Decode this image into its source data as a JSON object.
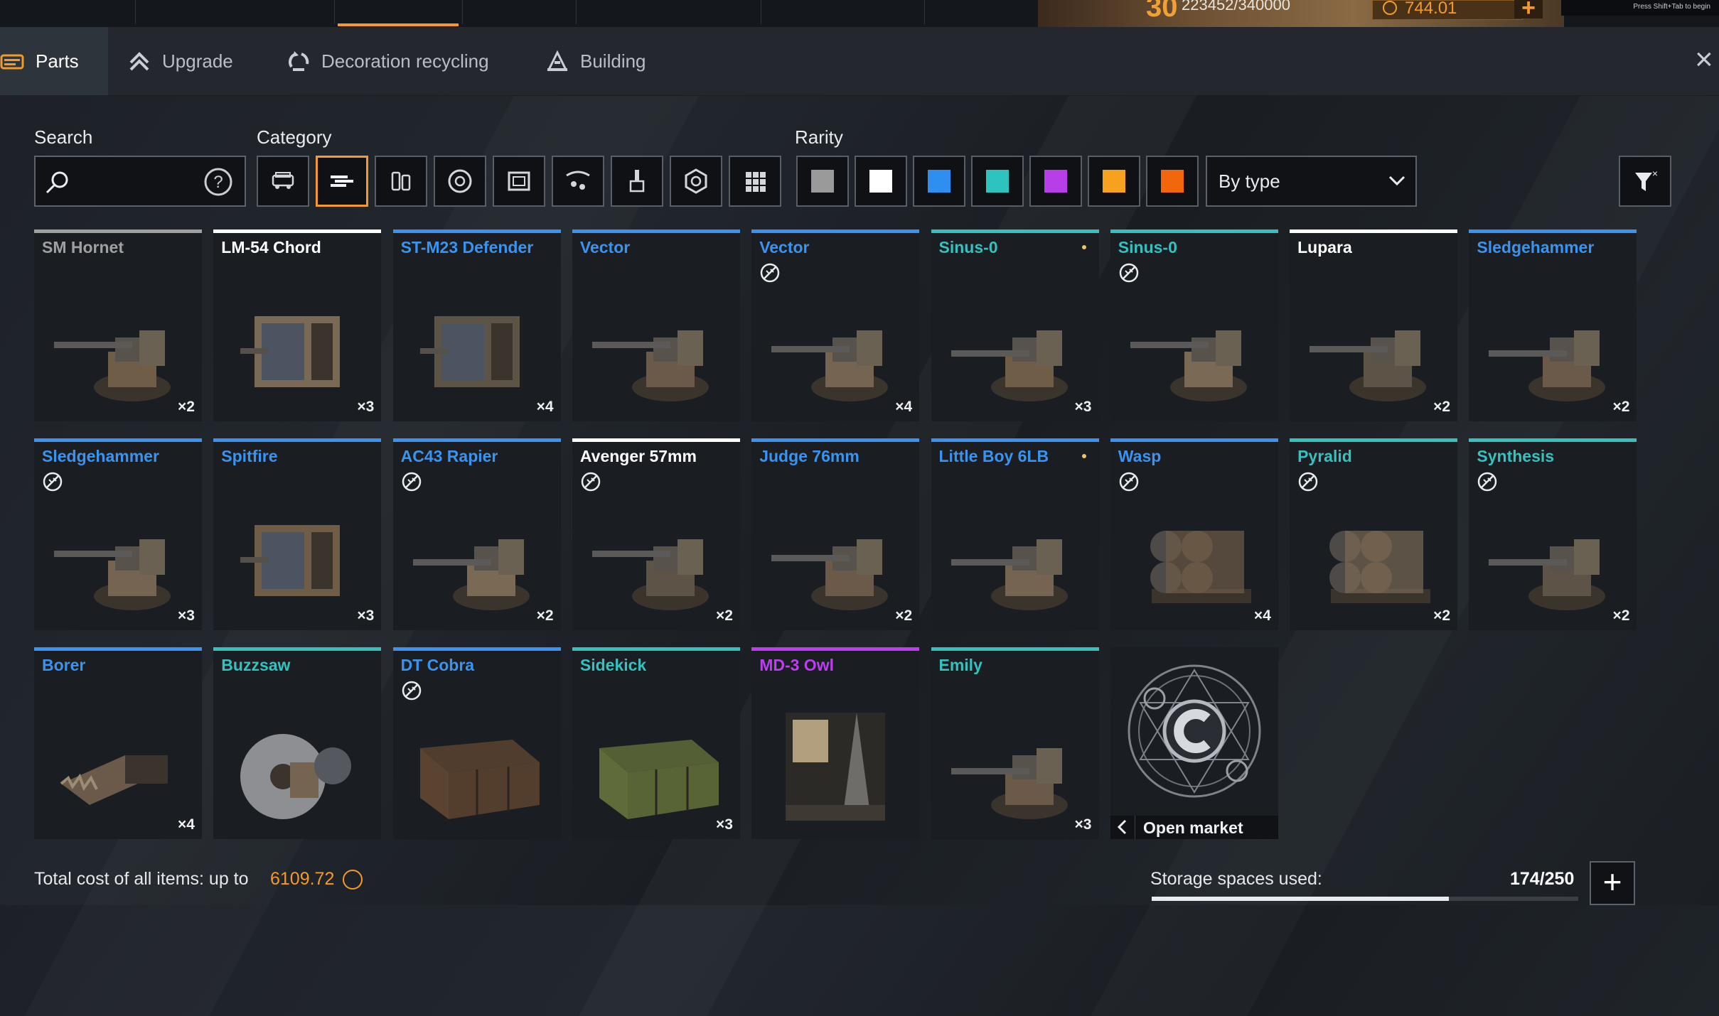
{
  "topbar": {
    "player_level": "30",
    "player_xp": "223452/340000",
    "coins": "744.01",
    "add_coins": "+",
    "hint": "Press Shift+Tab to begin"
  },
  "tabs": [
    {
      "label": "Parts",
      "icon": "parts-icon",
      "active": true
    },
    {
      "label": "Upgrade",
      "icon": "upgrade-icon",
      "active": false
    },
    {
      "label": "Decoration recycling",
      "icon": "recycling-icon",
      "active": false
    },
    {
      "label": "Building",
      "icon": "building-icon",
      "active": false
    }
  ],
  "close": "×",
  "filters": {
    "search_label": "Search",
    "category_label": "Category",
    "rarity_label": "Rarity",
    "categories": [
      "cabins-icon",
      "weapons-icon",
      "modules-icon",
      "wheels-icon",
      "frames-icon",
      "decor-icon",
      "paint-icon",
      "engines-icon",
      "all-icon"
    ],
    "selected_category": 1,
    "rarities": [
      {
        "name": "common",
        "color": "#9a9a9a"
      },
      {
        "name": "rare",
        "color": "#ffffff"
      },
      {
        "name": "special",
        "color": "#2e8ff0"
      },
      {
        "name": "epic",
        "color": "#2fc3c0"
      },
      {
        "name": "legendary",
        "color": "#b83ee8"
      },
      {
        "name": "relic",
        "color": "#f7a21e"
      },
      {
        "name": "exotic",
        "color": "#f2660c"
      }
    ],
    "sort": "By type"
  },
  "rarity_colors": {
    "common": "#a0a0a0",
    "rare": "#ffffff",
    "special": "#3a94ef",
    "epic": "#35c1bd",
    "legendary": "#bd3ef0"
  },
  "items": [
    {
      "name": "SM Hornet",
      "rarity": "common",
      "qty": "×2",
      "craftable": false,
      "dot": false
    },
    {
      "name": "LM-54 Chord",
      "rarity": "rare",
      "qty": "×3",
      "craftable": false,
      "dot": false
    },
    {
      "name": "ST-M23 Defender",
      "rarity": "special",
      "qty": "×4",
      "craftable": false,
      "dot": false
    },
    {
      "name": "Vector",
      "rarity": "special",
      "qty": "",
      "craftable": false,
      "dot": false
    },
    {
      "name": "Vector",
      "rarity": "special",
      "qty": "×4",
      "craftable": true,
      "dot": false
    },
    {
      "name": "Sinus-0",
      "rarity": "epic",
      "qty": "×3",
      "craftable": false,
      "dot": true
    },
    {
      "name": "Sinus-0",
      "rarity": "epic",
      "qty": "",
      "craftable": true,
      "dot": false
    },
    {
      "name": "Lupara",
      "rarity": "rare",
      "qty": "×2",
      "craftable": false,
      "dot": false
    },
    {
      "name": "Sledgehammer",
      "rarity": "special",
      "qty": "×2",
      "craftable": false,
      "dot": false
    },
    {
      "name": "Sledgehammer",
      "rarity": "special",
      "qty": "×3",
      "craftable": true,
      "dot": false
    },
    {
      "name": "Spitfire",
      "rarity": "special",
      "qty": "×3",
      "craftable": false,
      "dot": false
    },
    {
      "name": "AC43 Rapier",
      "rarity": "special",
      "qty": "×2",
      "craftable": true,
      "dot": false
    },
    {
      "name": "Avenger 57mm",
      "rarity": "rare",
      "qty": "×2",
      "craftable": true,
      "dot": false
    },
    {
      "name": "Judge 76mm",
      "rarity": "special",
      "qty": "×2",
      "craftable": false,
      "dot": false
    },
    {
      "name": "Little Boy 6LB",
      "rarity": "special",
      "qty": "",
      "craftable": false,
      "dot": true
    },
    {
      "name": "Wasp",
      "rarity": "special",
      "qty": "×4",
      "craftable": true,
      "dot": false
    },
    {
      "name": "Pyralid",
      "rarity": "epic",
      "qty": "×2",
      "craftable": true,
      "dot": false
    },
    {
      "name": "Synthesis",
      "rarity": "epic",
      "qty": "×2",
      "craftable": true,
      "dot": false
    },
    {
      "name": "Borer",
      "rarity": "special",
      "qty": "×4",
      "craftable": false,
      "dot": false
    },
    {
      "name": "Buzzsaw",
      "rarity": "epic",
      "qty": "",
      "craftable": false,
      "dot": false
    },
    {
      "name": "DT Cobra",
      "rarity": "special",
      "qty": "",
      "craftable": true,
      "dot": false
    },
    {
      "name": "Sidekick",
      "rarity": "epic",
      "qty": "×3",
      "craftable": false,
      "dot": false
    },
    {
      "name": "MD-3 Owl",
      "rarity": "legendary",
      "qty": "",
      "craftable": false,
      "dot": false
    },
    {
      "name": "Emily",
      "rarity": "epic",
      "qty": "×3",
      "craftable": false,
      "dot": false
    }
  ],
  "market": {
    "label": "Open market"
  },
  "footer": {
    "total_label": "Total cost of all items: up to",
    "total_value": "6109.72",
    "storage_label": "Storage spaces used:",
    "storage_value": "174/250",
    "storage_fraction": 0.696,
    "storage_add": "+"
  }
}
